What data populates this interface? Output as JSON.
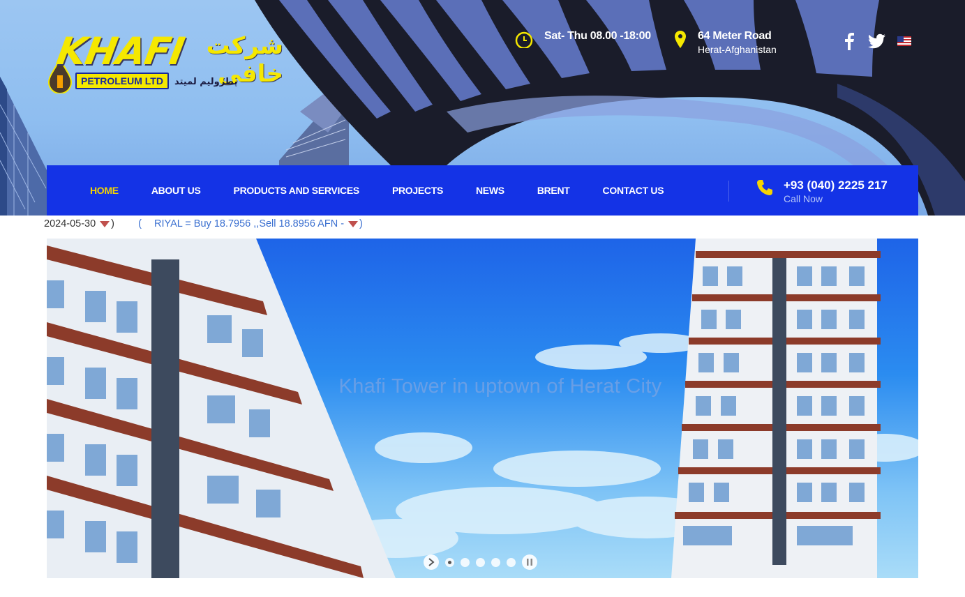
{
  "brand": {
    "logo_text": "KHAFI",
    "logo_subtitle": "PETROLEUM LTD",
    "logo_arabic": "شرکت خافی",
    "logo_arabic_sub": "پطرولیم لمیتد"
  },
  "header": {
    "hours": "Sat- Thu 08.00 -18:00",
    "address_line1": "64 Meter Road",
    "address_line2": "Herat-Afghanistan"
  },
  "social": {
    "facebook_icon": "facebook-icon",
    "twitter_icon": "twitter-icon",
    "language_icon": "us-flag-icon"
  },
  "nav": {
    "items": [
      {
        "label": "HOME",
        "active": true
      },
      {
        "label": "ABOUT US",
        "active": false
      },
      {
        "label": "PRODUCTS AND SERVICES",
        "active": false
      },
      {
        "label": "PROJECTS",
        "active": false
      },
      {
        "label": "NEWS",
        "active": false
      },
      {
        "label": "BRENT",
        "active": false
      },
      {
        "label": "CONTACT US",
        "active": false
      }
    ],
    "phone": "+93 (040) 2225 217",
    "phone_cta": "Call Now"
  },
  "ticker": {
    "date": "2024-05-30",
    "close1": ")",
    "open": "(",
    "rate_text": "RIYAL = Buy 18.7956 ,,Sell 18.8956  AFN -",
    "close2": ")"
  },
  "slider": {
    "caption": "Khafi Tower in uptown of Herat City",
    "slide_count": 5,
    "active_slide": 1
  },
  "colors": {
    "nav_bg": "#1433e6",
    "accent_yellow": "#f5d400",
    "ticker_link": "#3a6fd0"
  }
}
